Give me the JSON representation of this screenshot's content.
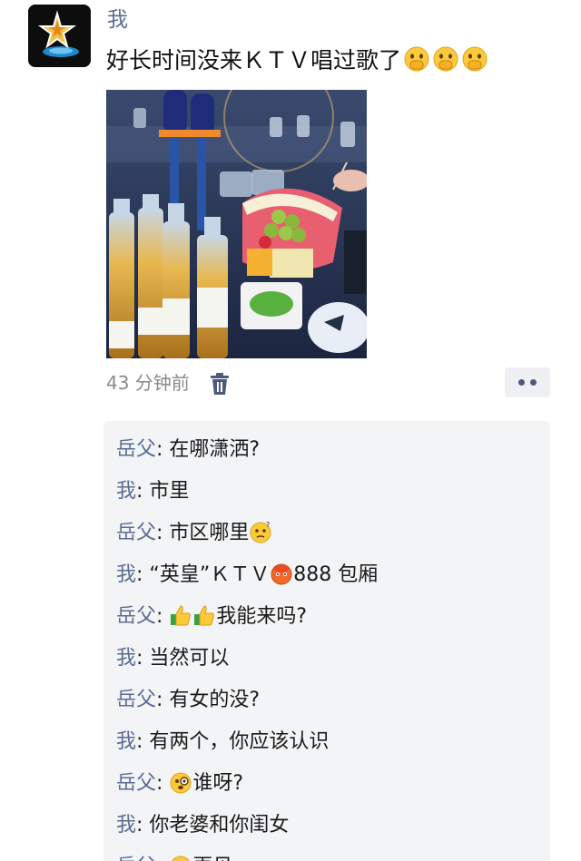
{
  "post": {
    "username": "我",
    "text": "好长时间没来ＫＴＶ唱过歌了",
    "time_ago": "43 分钟前"
  },
  "icons": {
    "avatar": "star-logo-icon",
    "delete": "trash-icon",
    "more": "more-dots-icon",
    "emoji_shush": "shushing-face-emoji",
    "emoji_think": "thinking-face-emoji",
    "emoji_thumb": "thumbs-up-emoji",
    "emoji_fire": "fire-face-emoji",
    "emoji_monocle": "monocle-face-emoji"
  },
  "colors": {
    "name_blue": "#5b6b92",
    "comment_bg": "#f3f4f6"
  },
  "comments": [
    {
      "who": "岳父",
      "text": "在哪潇洒?"
    },
    {
      "who": "我",
      "text": "市里"
    },
    {
      "who": "岳父",
      "text": "市区哪里"
    },
    {
      "who": "我",
      "text_a": "“英皇”ＫＴＶ",
      "text_b": "888 包厢"
    },
    {
      "who": "岳父",
      "text": "我能来吗?"
    },
    {
      "who": "我",
      "text": "当然可以"
    },
    {
      "who": "岳父",
      "text": "有女的没?"
    },
    {
      "who": "我",
      "text": "有两个，你应该认识"
    },
    {
      "who": "岳父",
      "text": "谁呀?"
    },
    {
      "who": "我",
      "text": "你老婆和你闺女"
    },
    {
      "who": "岳父",
      "text": "再见"
    }
  ],
  "separator": ": "
}
